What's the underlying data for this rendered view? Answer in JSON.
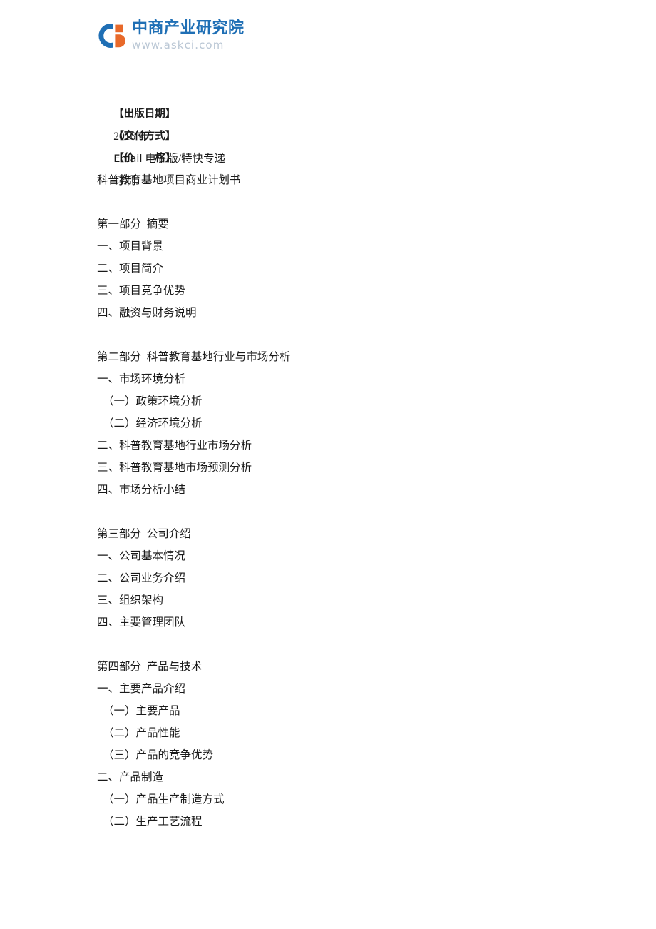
{
  "header": {
    "logo": {
      "mark_name": "askci-logo-mark",
      "colors": {
        "blue": "#1f6fb5",
        "orange": "#e8692a"
      },
      "company_cn": "中商产业研究院",
      "website": "www.askci.com"
    }
  },
  "document": {
    "meta": [
      {
        "label": "【出版日期】",
        "value": "2016 年",
        "latin": ""
      },
      {
        "label": "【交付方式】",
        "value": " 电子版/特快专递",
        "latin": "Email"
      },
      {
        "label": "【价　　格】",
        "value": "订制",
        "latin": ""
      }
    ],
    "title": "科普教育基地项目商业计划书",
    "sections": [
      {
        "heading": "第一部分  摘要",
        "items": [
          "一、项目背景",
          "二、项目简介",
          "三、项目竞争优势",
          "四、融资与财务说明"
        ]
      },
      {
        "heading": "第二部分  科普教育基地行业与市场分析",
        "items": [
          "一、市场环境分析",
          "（一）政策环境分析",
          "（二）经济环境分析",
          "二、科普教育基地行业市场分析",
          "三、科普教育基地市场预测分析",
          "四、市场分析小结"
        ]
      },
      {
        "heading": "第三部分  公司介绍",
        "items": [
          "一、公司基本情况",
          "二、公司业务介绍",
          "三、组织架构",
          "四、主要管理团队"
        ]
      },
      {
        "heading": "第四部分  产品与技术",
        "items": [
          "一、主要产品介绍",
          "（一）主要产品",
          "（二）产品性能",
          "（三）产品的竞争优势",
          "二、产品制造",
          "（一）产品生产制造方式",
          "（二）生产工艺流程"
        ]
      }
    ]
  }
}
